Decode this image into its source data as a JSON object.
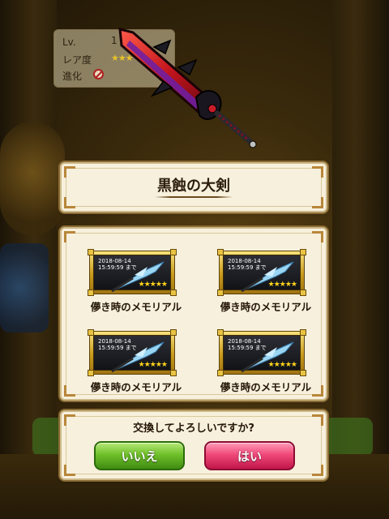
{
  "status": {
    "level_label": "Lv.",
    "level_value": "1",
    "rarity_label": "レア度",
    "evolution_label": "進化"
  },
  "title": "黒蝕の大剣",
  "items": [
    {
      "date": "2018-08-14",
      "time": "15:59:59 まで",
      "stars": "★★★★★",
      "name": "儚き時のメモリアル"
    },
    {
      "date": "2018-08-14",
      "time": "15:59:59 まで",
      "stars": "★★★★★",
      "name": "儚き時のメモリアル"
    },
    {
      "date": "2018-08-14",
      "time": "15:59:59 まで",
      "stars": "★★★★★",
      "name": "儚き時のメモリアル"
    },
    {
      "date": "2018-08-14",
      "time": "15:59:59 まで",
      "stars": "★★★★★",
      "name": "儚き時のメモリアル"
    }
  ],
  "confirm": {
    "question": "交換してよろしいですか?",
    "no_label": "いいえ",
    "yes_label": "はい"
  },
  "colors": {
    "panel": "#f7f0dc",
    "button_no": "#6fc02a",
    "button_yes": "#f04a7a",
    "card_frame": "#c99a1c"
  },
  "icons": [
    "sword-image",
    "spear-icon",
    "no-evolution-icon",
    "star-icon"
  ]
}
